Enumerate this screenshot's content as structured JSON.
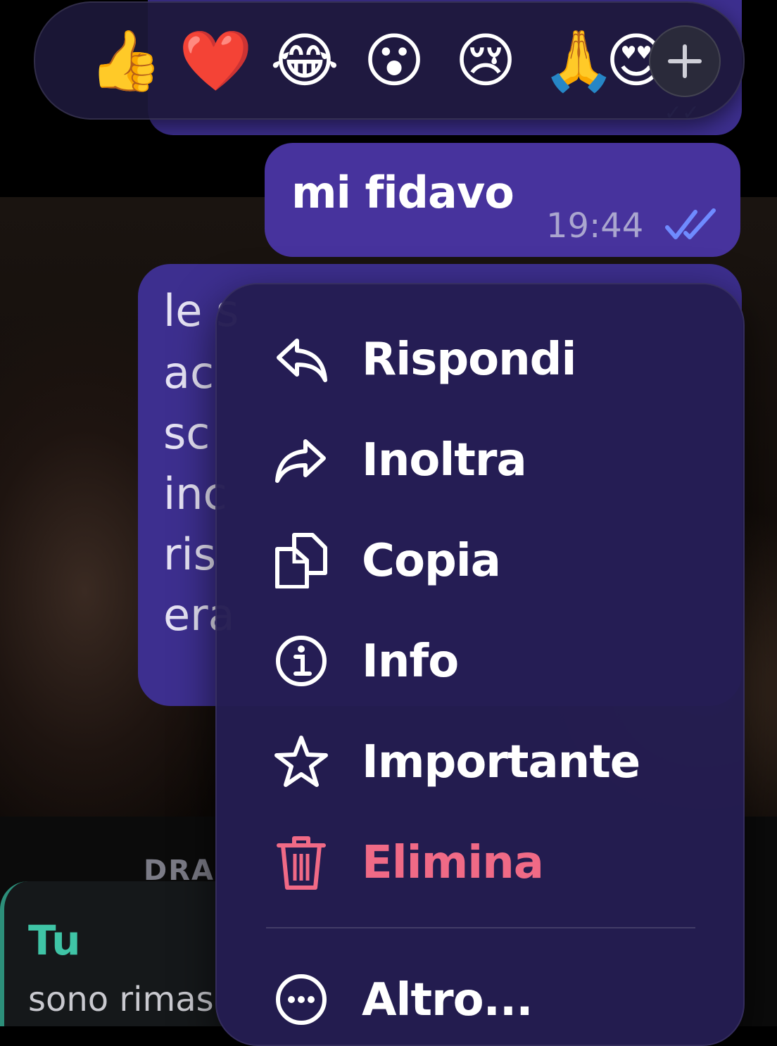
{
  "reactions": {
    "emojis": [
      "👍",
      "❤️",
      "😂",
      "😮",
      "😢",
      "🙏",
      "😍"
    ],
    "more_label": "+"
  },
  "sent_message": {
    "text": "mi fidavo",
    "time": "19:44"
  },
  "partial_message": {
    "lines": [
      "le s",
      "ac",
      "sc",
      "inc",
      "ris",
      "era"
    ]
  },
  "context_menu": {
    "items": [
      {
        "label": "Rispondi",
        "icon": "reply-icon"
      },
      {
        "label": "Inoltra",
        "icon": "forward-icon"
      },
      {
        "label": "Copia",
        "icon": "copy-icon"
      },
      {
        "label": "Info",
        "icon": "info-icon"
      },
      {
        "label": "Importante",
        "icon": "star-icon"
      },
      {
        "label": "Elimina",
        "icon": "trash-icon"
      },
      {
        "label": "Altro...",
        "icon": "more-icon"
      }
    ]
  },
  "section_label": "DRA",
  "reply_preview": {
    "sender": "Tu",
    "text": "sono rimas"
  },
  "colors": {
    "bubble": "#47339d",
    "menu_bg": "#241d52",
    "danger": "#f06a86",
    "accent_green": "#3fc4a6",
    "read_ticks": "#6f8bff"
  }
}
